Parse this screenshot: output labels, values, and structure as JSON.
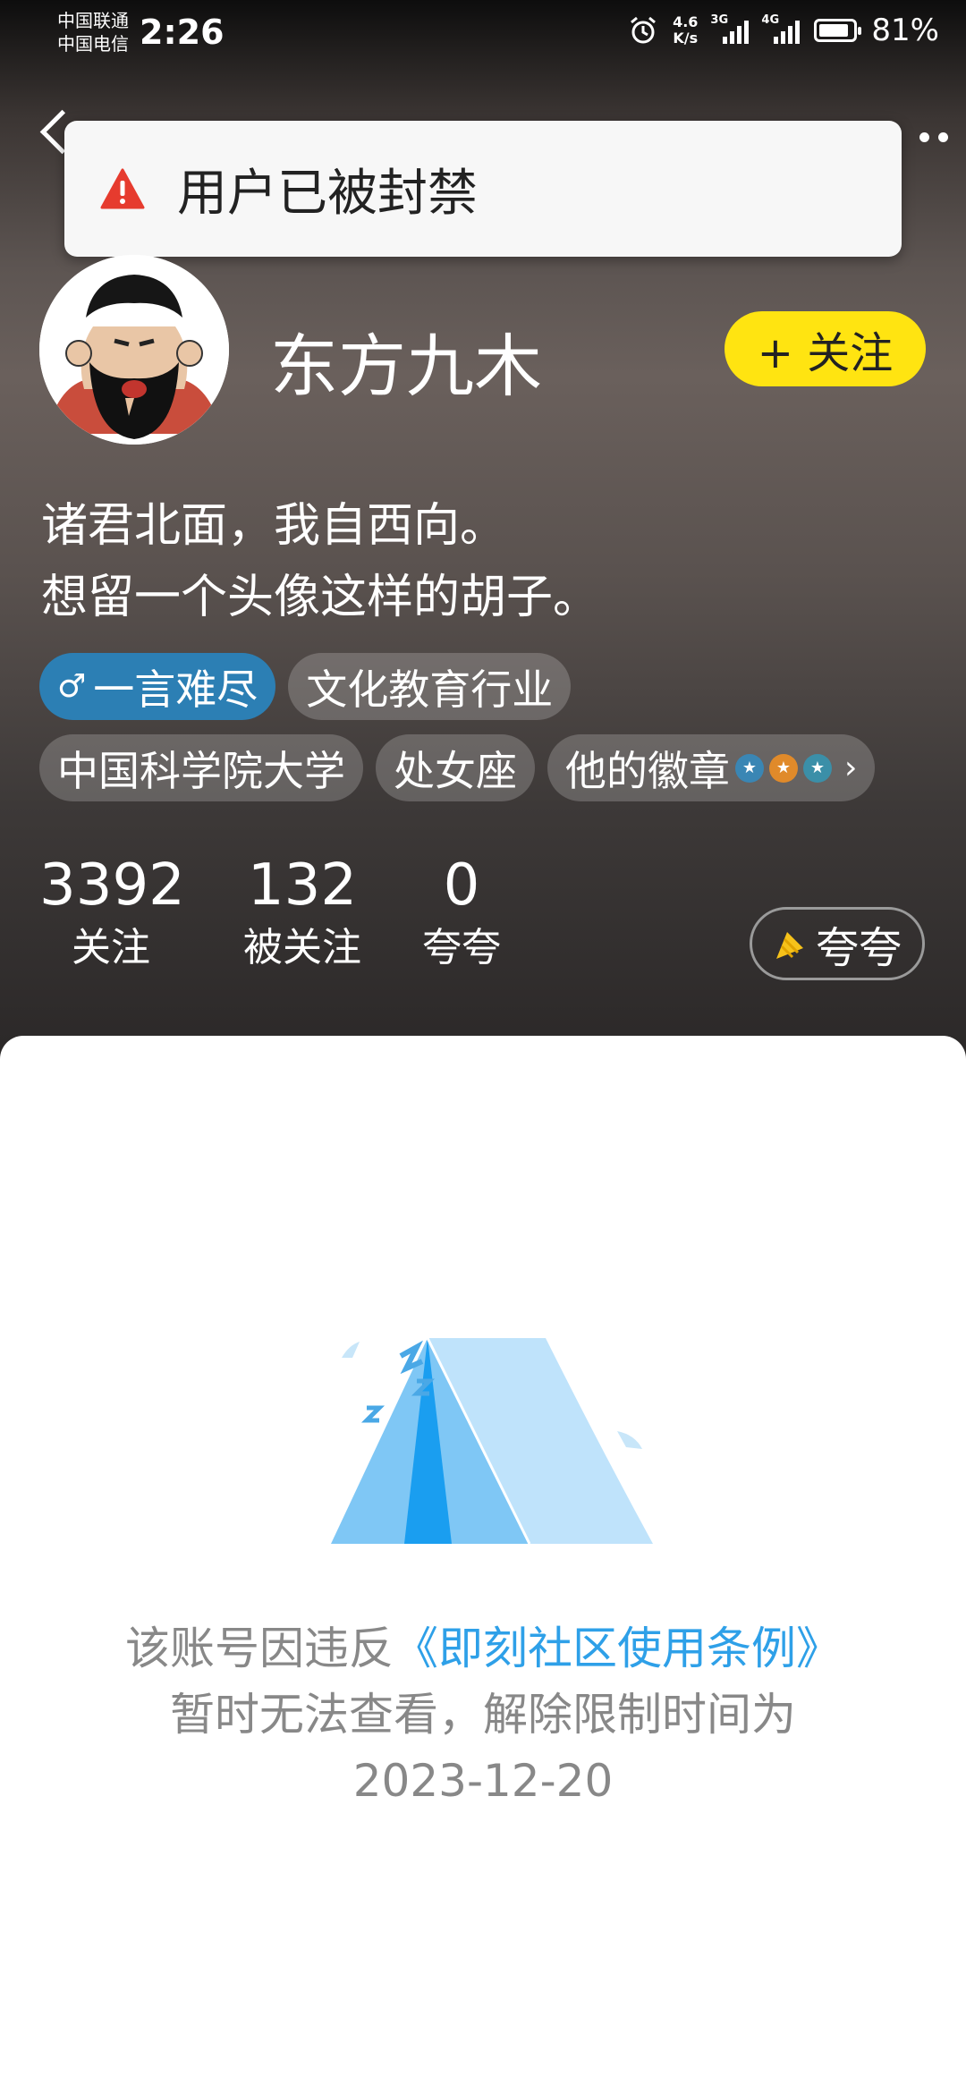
{
  "status_bar": {
    "carrier_1": "中国联通",
    "carrier_2": "中国电信",
    "time": "2:26",
    "net_speed_value": "4.6",
    "net_speed_unit": "K/s",
    "signal_1_type": "3G",
    "signal_2_type": "4G",
    "battery_percent": "81%",
    "battery_level": 0.81
  },
  "toast": {
    "text": "用户已被封禁",
    "icon": "warning-icon"
  },
  "profile": {
    "name": "东方九木",
    "follow_label": "+ 关注",
    "bio_line_1": "诸君北面，我自西向。",
    "bio_line_2": "想留一个头像这样的胡子。",
    "tags": {
      "gender_symbol": "♂",
      "gender_text": "一言难尽",
      "industry": "文化教育行业",
      "school": "中国科学院大学",
      "zodiac": "处女座",
      "badges_label": "他的徽章"
    }
  },
  "stats": {
    "following_count": "3392",
    "following_label": "关注",
    "followers_count": "132",
    "followers_label": "被关注",
    "praise_count": "0",
    "praise_label": "夸夸"
  },
  "praise_button": {
    "label": "夸夸"
  },
  "banned_notice": {
    "line_1_prefix": "该账号因违反",
    "line_1_link": "《即刻社区使用条例》",
    "line_2": "暂时无法查看，解除限制时间为",
    "line_3": "2023-12-20"
  },
  "colors": {
    "follow_button": "#ffe411",
    "gender_tag": "#2c7fb4",
    "link": "#2ea0e8",
    "warning": "#e63b2e"
  }
}
